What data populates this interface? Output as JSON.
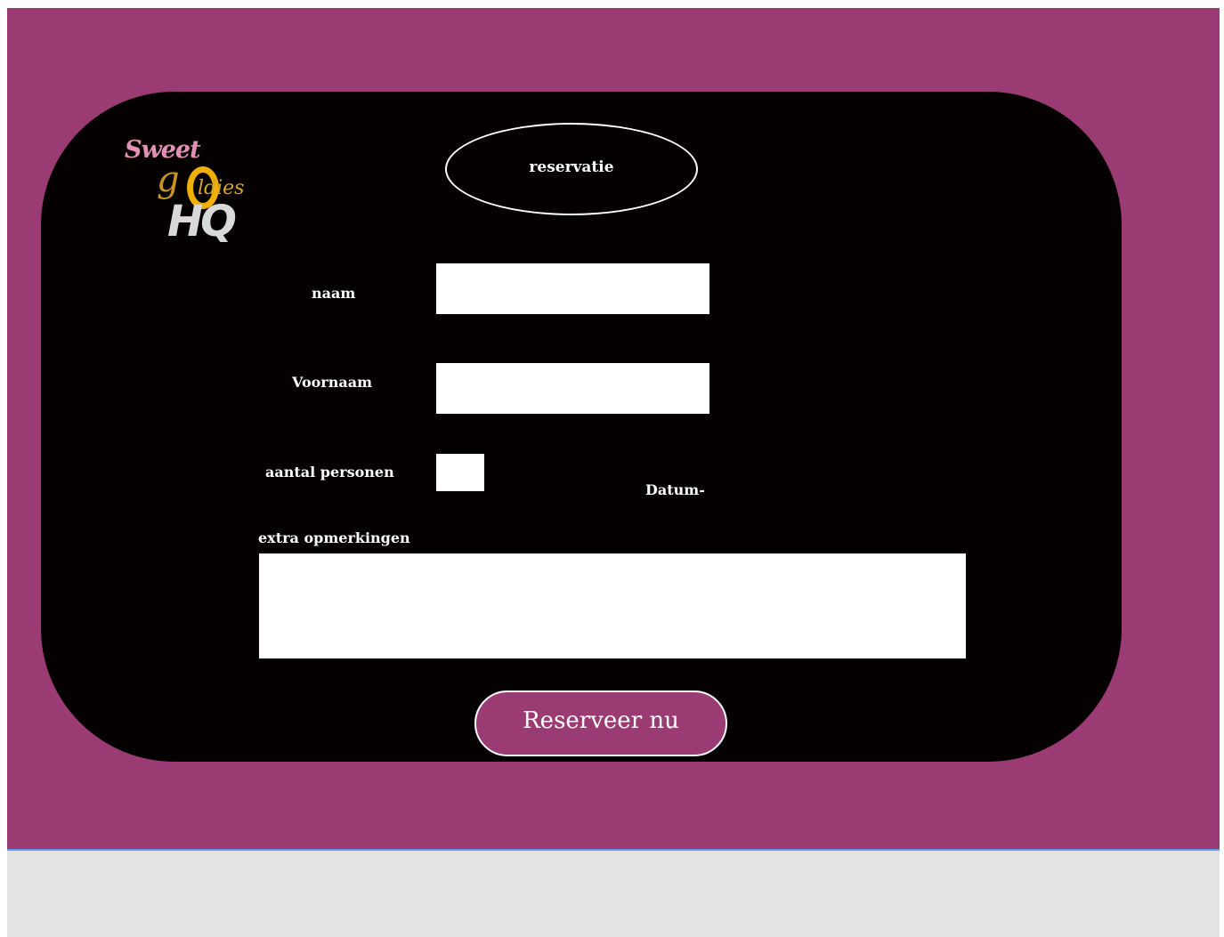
{
  "logo": {
    "word_top": "Sweet",
    "letter_g": "g",
    "word_oldies": "ldies",
    "word_bottom": "HQ"
  },
  "form": {
    "title": "reservatie",
    "naam_label": "naam",
    "naam_value": "",
    "voornaam_label": "Voornaam",
    "voornaam_value": "",
    "aantal_label": "aantal personen",
    "aantal_value": "",
    "datum_label": "Datum-",
    "opmerkingen_label": "extra opmerkingen",
    "opmerkingen_value": "",
    "submit_label": "Reserveer nu"
  },
  "colors": {
    "page_background": "#9b3b74",
    "card_background": "#050000",
    "button_background": "#9b3b74",
    "field_background": "#ffffff",
    "text": "#ffffff",
    "logo_pink": "#e191b4",
    "logo_gold": "#f0b000",
    "logo_grey": "#d9d9d9",
    "bottom_area": "#e3e3e3",
    "divider": "#5aa0e6"
  }
}
